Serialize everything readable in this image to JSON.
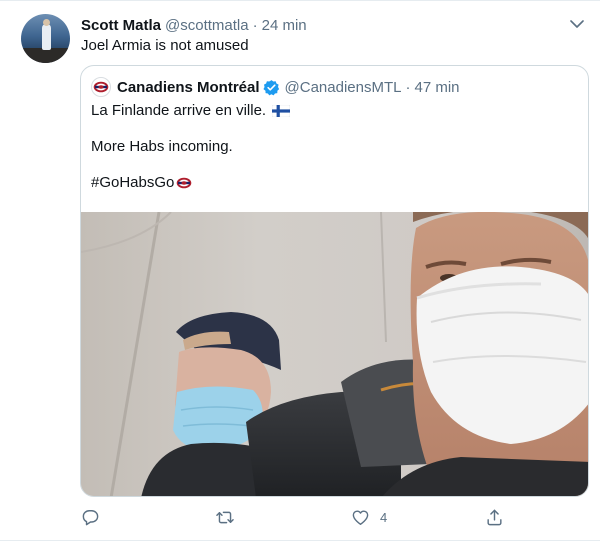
{
  "tweet": {
    "author_name": "Scott Matla",
    "author_handle": "@scottmatla",
    "separator": "·",
    "time": "24 min",
    "text": "Joel Armia is not amused"
  },
  "quoted": {
    "author_name": "Canadiens Montréal",
    "author_handle": "@CanadiensMTL",
    "separator": "·",
    "time": "47 min",
    "line1": "La Finlande arrive en ville.",
    "line2": "More Habs incoming.",
    "hashtag": "#GoHabsGo"
  },
  "actions": {
    "like_count": "4"
  },
  "colors": {
    "text_primary": "#0f1419",
    "text_secondary": "#5b7083",
    "verified_blue": "#1d9bf0",
    "habs_red": "#af1e2d",
    "habs_blue": "#192168"
  }
}
